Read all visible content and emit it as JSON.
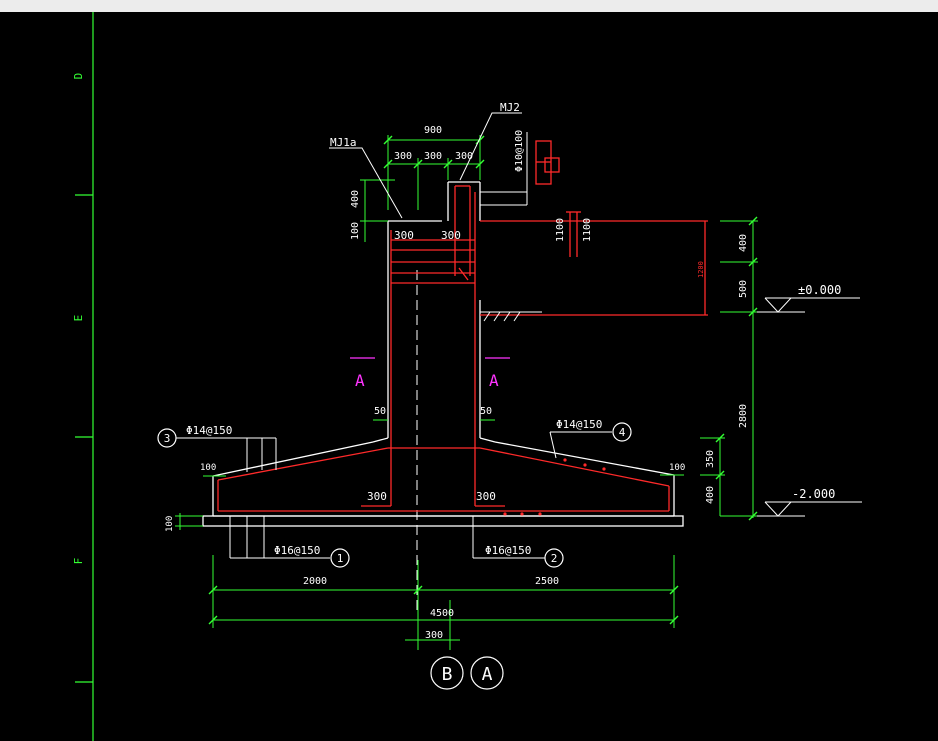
{
  "window": {
    "titlebar_color": "#ececec",
    "background": "#000000"
  },
  "colors": {
    "white": "#ffffff",
    "red": "#ff2a2a",
    "green": "#33ff33",
    "magenta": "#ff33ff"
  },
  "ruler": {
    "labels": [
      "D",
      "E",
      "F"
    ]
  },
  "labels": {
    "mj1a": "MJ1a",
    "mj2": "MJ2",
    "dim_900": "900",
    "dim_300a": "300",
    "dim_300b": "300",
    "dim_300c": "300",
    "rebar_top": "Φ10@100",
    "dim_400_left": "400",
    "dim_100_left": "100",
    "col_300_left": "300",
    "col_300_right": "300",
    "dim_1100a": "1100",
    "dim_1100b": "1100",
    "dim_1200_red": "1200",
    "dim_400_right": "400",
    "dim_500_right": "500",
    "level_zero": "±0.000",
    "dim_2800": "2800",
    "section_left": "A",
    "section_right": "A",
    "dim_50_left": "50",
    "dim_50_right": "50",
    "rebar_3": "Φ14@150",
    "circle_3": "3",
    "rebar_4": "Φ14@150",
    "circle_4": "4",
    "dim_100_l": "100",
    "dim_100_r": "100",
    "dim_350": "350",
    "dim_400_low": "400",
    "level_neg": "-2.000",
    "base_300_left": "300",
    "base_300_right": "300",
    "dim_100_bed": "100",
    "rebar_1": "Φ16@150",
    "circle_1": "1",
    "rebar_2": "Φ16@150",
    "circle_2": "2",
    "dim_2000": "2000",
    "dim_2500": "2500",
    "dim_4500": "4500",
    "dim_300_axis": "300",
    "axis_b": "B",
    "axis_a": "A"
  }
}
